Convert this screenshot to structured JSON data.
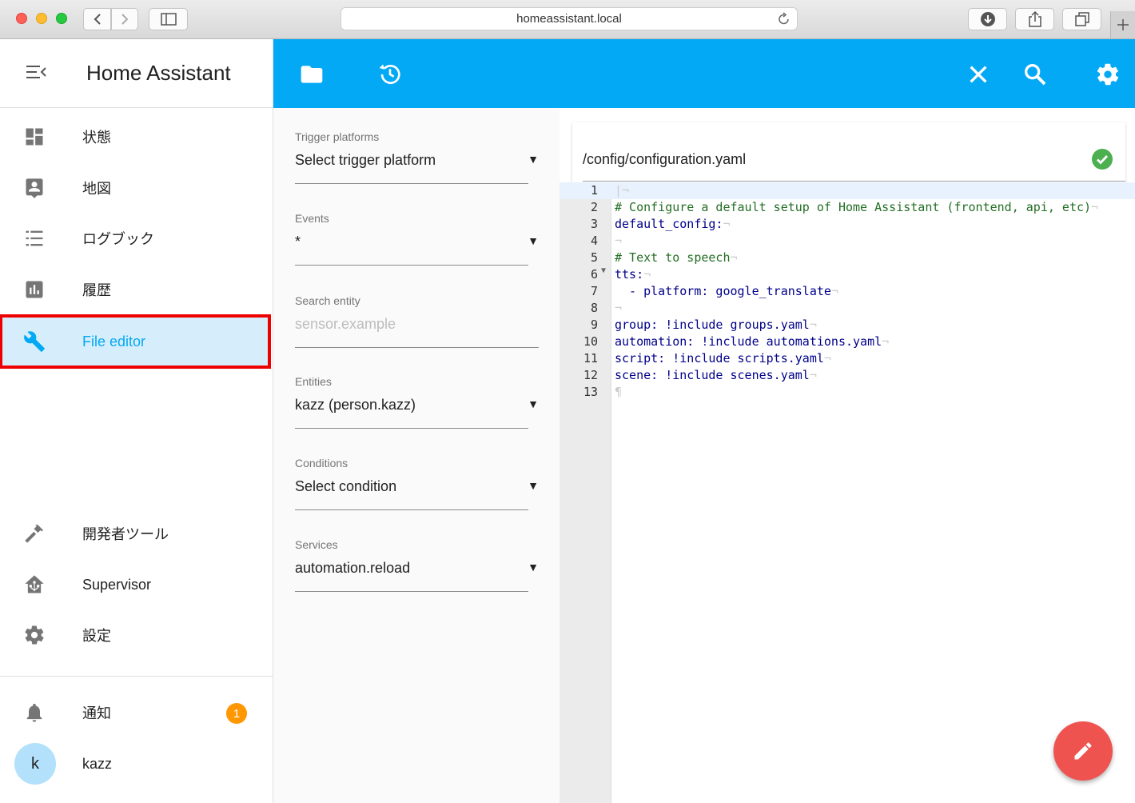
{
  "browser": {
    "url": "homeassistant.local"
  },
  "sidebar": {
    "title": "Home Assistant",
    "items": [
      {
        "label": "状態",
        "icon": "dashboard-icon"
      },
      {
        "label": "地図",
        "icon": "map-account-icon"
      },
      {
        "label": "ログブック",
        "icon": "logbook-list-icon"
      },
      {
        "label": "履歴",
        "icon": "history-chart-icon"
      },
      {
        "label": "File editor",
        "icon": "wrench-icon",
        "active": true
      }
    ],
    "bottom_items": [
      {
        "label": "開発者ツール",
        "icon": "hammer-icon"
      },
      {
        "label": "Supervisor",
        "icon": "home-assistant-icon"
      },
      {
        "label": "設定",
        "icon": "gear-icon"
      }
    ],
    "notifications": {
      "label": "通知",
      "count": "1"
    },
    "user": {
      "name": "kazz",
      "initial": "k"
    }
  },
  "panel": {
    "trigger": {
      "label": "Trigger platforms",
      "value": "Select trigger platform"
    },
    "events": {
      "label": "Events",
      "value": "*"
    },
    "search_entity": {
      "label": "Search entity",
      "placeholder": "sensor.example"
    },
    "entities": {
      "label": "Entities",
      "value": "kazz (person.kazz)"
    },
    "conditions": {
      "label": "Conditions",
      "value": "Select condition"
    },
    "services": {
      "label": "Services",
      "value": "automation.reload"
    }
  },
  "editor": {
    "file_path": "/config/configuration.yaml",
    "lines": [
      {
        "n": "1",
        "text": ""
      },
      {
        "n": "2",
        "text": "# Configure a default setup of Home Assistant (frontend, api, etc)"
      },
      {
        "n": "3",
        "text": "default_config:"
      },
      {
        "n": "4",
        "text": ""
      },
      {
        "n": "5",
        "text": "# Text to speech"
      },
      {
        "n": "6",
        "text": "tts:"
      },
      {
        "n": "7",
        "text": "  - platform: google_translate"
      },
      {
        "n": "8",
        "text": ""
      },
      {
        "n": "9",
        "text": "group: !include groups.yaml"
      },
      {
        "n": "10",
        "text": "automation: !include automations.yaml"
      },
      {
        "n": "11",
        "text": "script: !include scripts.yaml"
      },
      {
        "n": "12",
        "text": "scene: !include scenes.yaml"
      },
      {
        "n": "13",
        "text": ""
      }
    ]
  },
  "colors": {
    "accent": "#03a9f4",
    "fab": "#ef5350",
    "badge": "#ff9800",
    "active_bg": "#d6eefb"
  }
}
